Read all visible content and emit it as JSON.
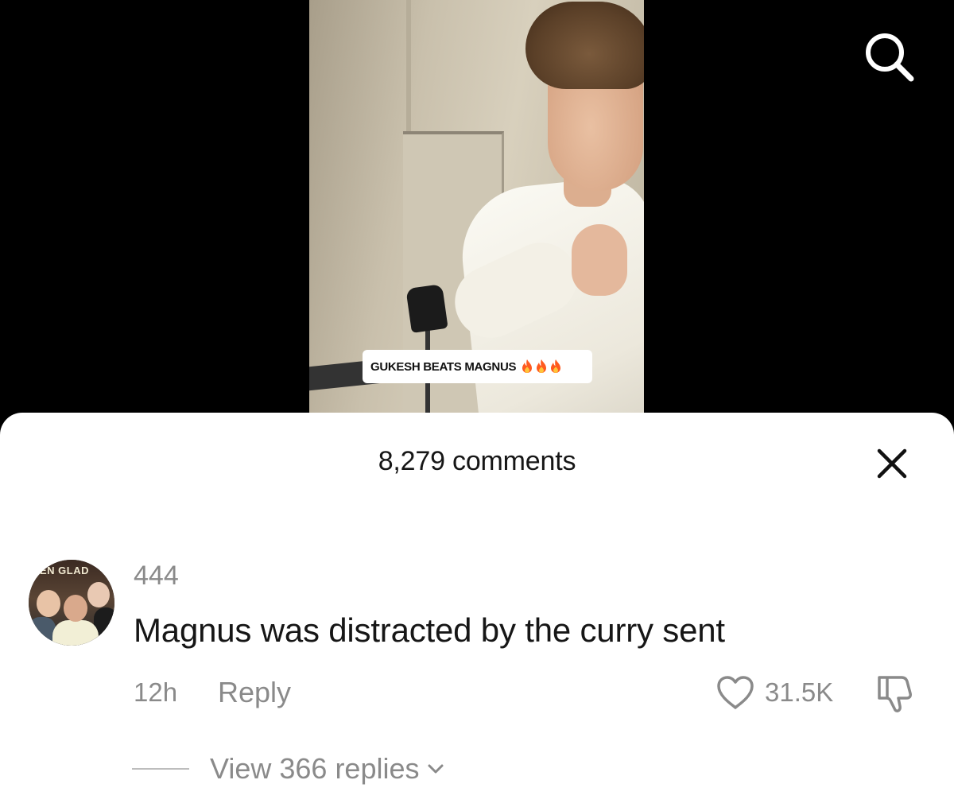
{
  "video": {
    "caption": "GUKESH BEATS MAGNUS",
    "caption_emoji": [
      "fire-icon",
      "fire-icon",
      "fire-icon"
    ]
  },
  "header": {
    "search_icon": "search-icon"
  },
  "comments_panel": {
    "title": "8,279 comments",
    "close_icon": "close-icon"
  },
  "comment": {
    "username": "444",
    "avatar_text": "EN GLAD",
    "text": "Magnus was distracted by the curry sent",
    "time": "12h",
    "reply_label": "Reply",
    "like_count": "31.5K",
    "view_replies_label": "View 366 replies"
  },
  "colors": {
    "secondary_text": "#8a8a8a",
    "primary_text": "#161616",
    "sheet_background": "#ffffff",
    "fire": "#ff5a1f"
  }
}
